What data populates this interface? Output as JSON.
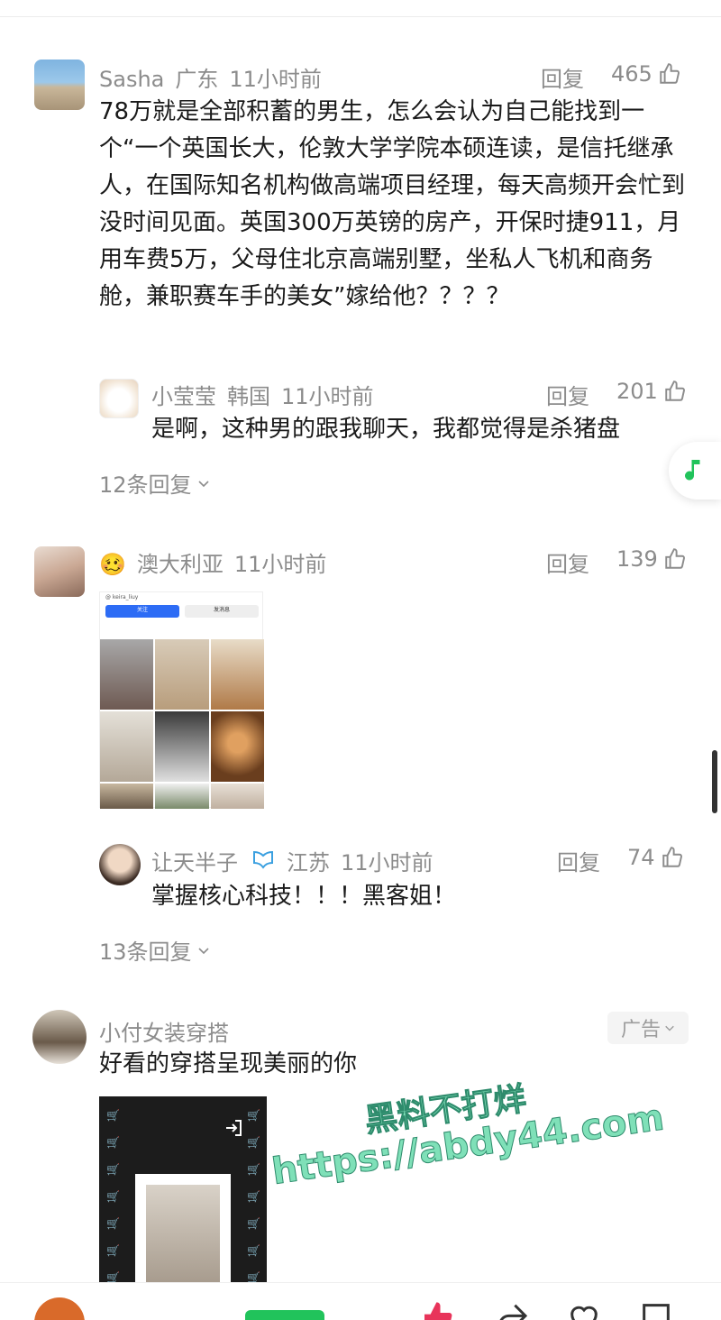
{
  "comments": [
    {
      "user": "Sasha",
      "location": "广东",
      "time": "11小时前",
      "reply_label": "回复",
      "likes": "465",
      "text": "78万就是全部积蓄的男生，怎么会认为自己能找到一个“一个英国长大，伦敦大学学院本硕连读，是信托继承人，在国际知名机构做高端项目经理，每天高频开会忙到没时间见面。英国300万英镑的房产，开保时捷911，月用车费5万，父母住北京高端别墅，坐私人飞机和商务舱，兼职赛车手的美女”嫁给他？？？？",
      "sub_reply": {
        "user": "小莹莹",
        "location": "韩国",
        "time": "11小时前",
        "reply_label": "回复",
        "likes": "201",
        "text": "是啊，这种男的跟我聊天，我都觉得是杀猪盘"
      },
      "more_replies": "12条回复"
    },
    {
      "user_emoji": "🥴",
      "location": "澳大利亚",
      "time": "11小时前",
      "reply_label": "回复",
      "likes": "139",
      "image_grid": {
        "handle": "@ keira_liuy",
        "tab1": "关注",
        "tab2": "发消息"
      },
      "sub_reply": {
        "user": "让天半子",
        "location": "江苏",
        "time": "11小时前",
        "reply_label": "回复",
        "likes": "74",
        "text": "掌握核心科技！！！黑客姐！"
      },
      "more_replies": "13条回复"
    }
  ],
  "ad": {
    "user": "小付女装穿搭",
    "badge": "广告",
    "text": "好看的穿搭呈现美丽的你"
  },
  "watermark": {
    "line1": "黑料不打烊",
    "line2": "https://abdy44.com"
  },
  "colors": {
    "accent": "#21c35b",
    "meta": "#8c8c8c",
    "like_active": "#e8345a"
  }
}
